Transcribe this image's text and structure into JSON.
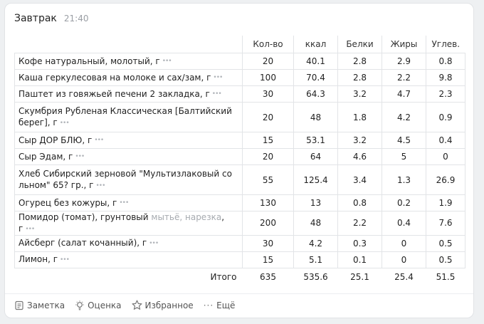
{
  "meal": {
    "title": "Завтрак",
    "time": "21:40"
  },
  "columns": [
    "Кол-во",
    "ккал",
    "Белки",
    "Жиры",
    "Углев."
  ],
  "items": [
    {
      "name": "Кофе натуральный, молотый, г",
      "note": "",
      "qty": "20",
      "kcal": "40.1",
      "protein": "2.8",
      "fat": "2.9",
      "carbs": "0.8"
    },
    {
      "name": "Каша геркулесовая на молоке и сах/зам, г",
      "note": "",
      "qty": "100",
      "kcal": "70.4",
      "protein": "2.8",
      "fat": "2.2",
      "carbs": "9.8"
    },
    {
      "name": "Паштет из говяжьей печени 2 закладка, г",
      "note": "",
      "qty": "30",
      "kcal": "64.3",
      "protein": "3.2",
      "fat": "4.7",
      "carbs": "2.3"
    },
    {
      "name": "Скумбрия Рубленая Классическая [Балтийский берег], г",
      "note": "",
      "qty": "20",
      "kcal": "48",
      "protein": "1.8",
      "fat": "4.2",
      "carbs": "0.9"
    },
    {
      "name": "Сыр ДОР БЛЮ, г",
      "note": "",
      "qty": "15",
      "kcal": "53.1",
      "protein": "3.2",
      "fat": "4.5",
      "carbs": "0.4"
    },
    {
      "name": "Сыр Эдам, г",
      "note": "",
      "qty": "20",
      "kcal": "64",
      "protein": "4.6",
      "fat": "5",
      "carbs": "0"
    },
    {
      "name": "Хлеб Сибирский зерновой \"Мультизлаковый со льном\" 65? гр., г",
      "note": "",
      "qty": "55",
      "kcal": "125.4",
      "protein": "3.4",
      "fat": "1.3",
      "carbs": "26.9"
    },
    {
      "name": "Огурец без кожуры, г",
      "note": "",
      "qty": "130",
      "kcal": "13",
      "protein": "0.8",
      "fat": "0.2",
      "carbs": "1.9"
    },
    {
      "name": "Помидор (томат), грунтовый",
      "note": "мытьё, нарезка",
      "suffix": ", г",
      "qty": "200",
      "kcal": "48",
      "protein": "2.2",
      "fat": "0.4",
      "carbs": "7.6"
    },
    {
      "name": "Айсберг (салат кочанный), г",
      "note": "",
      "qty": "30",
      "kcal": "4.2",
      "protein": "0.3",
      "fat": "0",
      "carbs": "0.5"
    },
    {
      "name": "Лимон, г",
      "note": "",
      "qty": "15",
      "kcal": "5.1",
      "protein": "0.1",
      "fat": "0",
      "carbs": "0.5"
    }
  ],
  "total": {
    "label": "Итого",
    "qty": "635",
    "kcal": "535.6",
    "protein": "25.1",
    "fat": "25.4",
    "carbs": "51.5"
  },
  "actions": [
    {
      "label": "Заметка",
      "icon": "note-icon"
    },
    {
      "label": "Оценка",
      "icon": "lightbulb-icon"
    },
    {
      "label": "Избранное",
      "icon": "star-icon"
    },
    {
      "label": "Ещё",
      "icon": "more-dots-icon"
    }
  ]
}
